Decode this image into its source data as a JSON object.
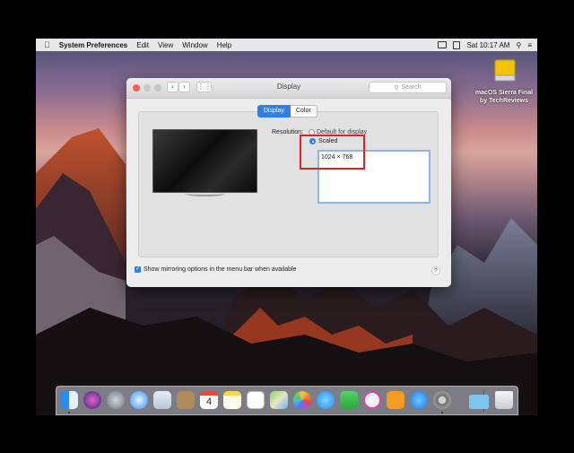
{
  "menubar": {
    "apple": "",
    "app_name": "System Preferences",
    "menus": [
      "Edit",
      "View",
      "Window",
      "Help"
    ],
    "clock": "Sat 10:17 AM"
  },
  "desktop": {
    "drive_label_line1": "macOS Sierra Final",
    "drive_label_line2": "by TechReviews"
  },
  "window": {
    "title": "Display",
    "search_placeholder": "Search",
    "tabs": [
      "Display",
      "Color"
    ],
    "resolution_label": "Resolution:",
    "default_option": "Default for display",
    "scaled_option": "Scaled",
    "resolution_list": [
      "1024 × 768"
    ],
    "mirror_option": "Show mirroring options in the menu bar when available",
    "help": "?"
  },
  "colors": {
    "accent": "#2f7fe8",
    "highlight_box": "#e3202a"
  },
  "dock": {
    "items": [
      "finder-icon",
      "siri-icon",
      "launchpad-icon",
      "safari-icon",
      "mail-icon",
      "contacts-icon",
      "calendar-icon",
      "notes-icon",
      "reminders-icon",
      "maps-icon",
      "photos-icon",
      "messages-icon",
      "facetime-icon",
      "itunes-icon",
      "ibooks-icon",
      "app-store-icon",
      "system-preferences-icon",
      "downloads-folder-icon",
      "trash-icon"
    ],
    "calendar_day": "4"
  }
}
